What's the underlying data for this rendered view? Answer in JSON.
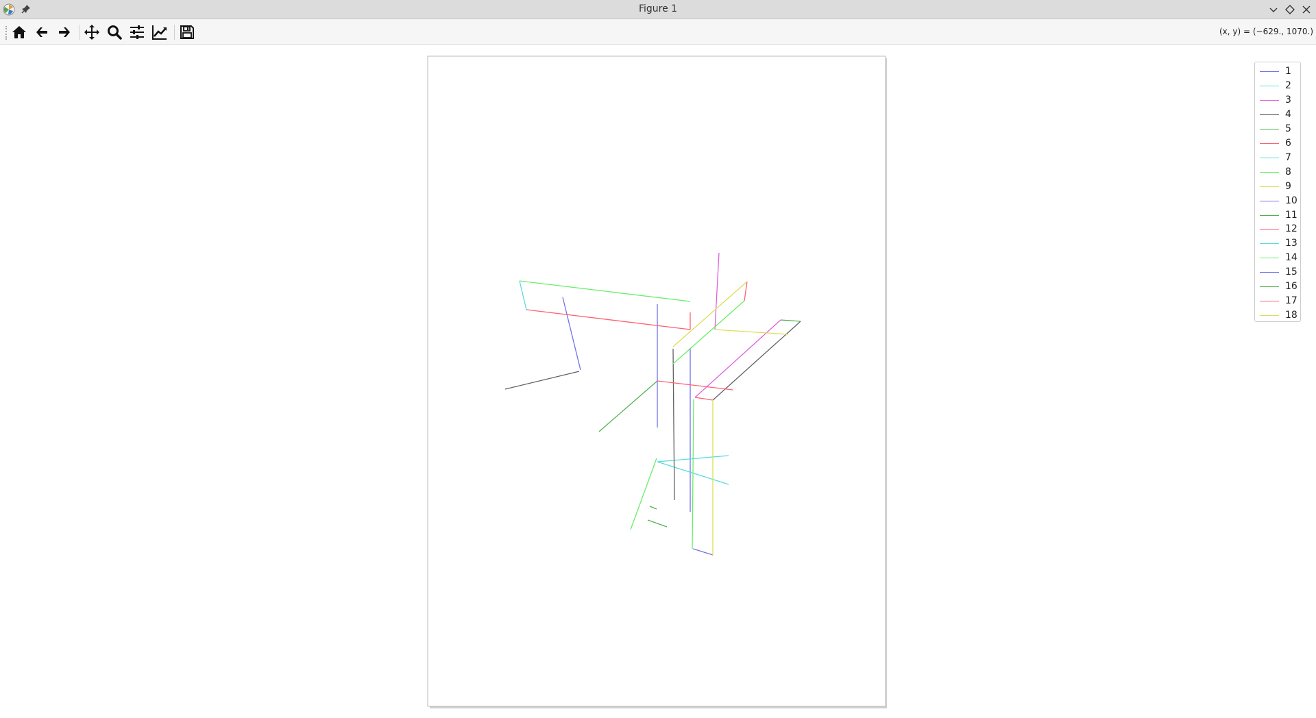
{
  "window": {
    "title": "Figure 1"
  },
  "toolbar": {
    "buttons": [
      {
        "name": "home-button",
        "icon": "home-icon",
        "tooltip": "Reset original view"
      },
      {
        "name": "back-button",
        "icon": "arrow-left-icon",
        "tooltip": "Back to previous view"
      },
      {
        "name": "forward-button",
        "icon": "arrow-right-icon",
        "tooltip": "Forward to next view"
      },
      {
        "name": "pan-button",
        "icon": "move-icon",
        "tooltip": "Pan axes"
      },
      {
        "name": "zoom-button",
        "icon": "magnifier-icon",
        "tooltip": "Zoom to rectangle"
      },
      {
        "name": "subplots-button",
        "icon": "sliders-icon",
        "tooltip": "Configure subplots"
      },
      {
        "name": "edit-curves-button",
        "icon": "line-chart-icon",
        "tooltip": "Edit axis, curve and image parameters"
      },
      {
        "name": "save-button",
        "icon": "floppy-disk-icon",
        "tooltip": "Save the figure"
      }
    ],
    "coords_text": "(x, y) = (−629., 1070.)"
  },
  "chart_data": {
    "type": "line",
    "projection": "3d",
    "axes_visible": false,
    "grid": false,
    "legend_placement": "top-right",
    "series": [
      {
        "name": "1",
        "color": "#7070ee"
      },
      {
        "name": "2",
        "color": "#55dddd"
      },
      {
        "name": "3",
        "color": "#e060e0"
      },
      {
        "name": "4",
        "color": "#606060"
      },
      {
        "name": "5",
        "color": "#50b050"
      },
      {
        "name": "6",
        "color": "#ff6070"
      },
      {
        "name": "7",
        "color": "#55dddd"
      },
      {
        "name": "8",
        "color": "#66ee66"
      },
      {
        "name": "9",
        "color": "#dddd55"
      },
      {
        "name": "10",
        "color": "#7070ee"
      },
      {
        "name": "11",
        "color": "#50b050"
      },
      {
        "name": "12",
        "color": "#ff6070"
      },
      {
        "name": "13",
        "color": "#55dddd"
      },
      {
        "name": "14",
        "color": "#66ee66"
      },
      {
        "name": "15",
        "color": "#7070ee"
      },
      {
        "name": "16",
        "color": "#50b050"
      },
      {
        "name": "17",
        "color": "#ff6070"
      },
      {
        "name": "18",
        "color": "#dddd55"
      }
    ]
  }
}
